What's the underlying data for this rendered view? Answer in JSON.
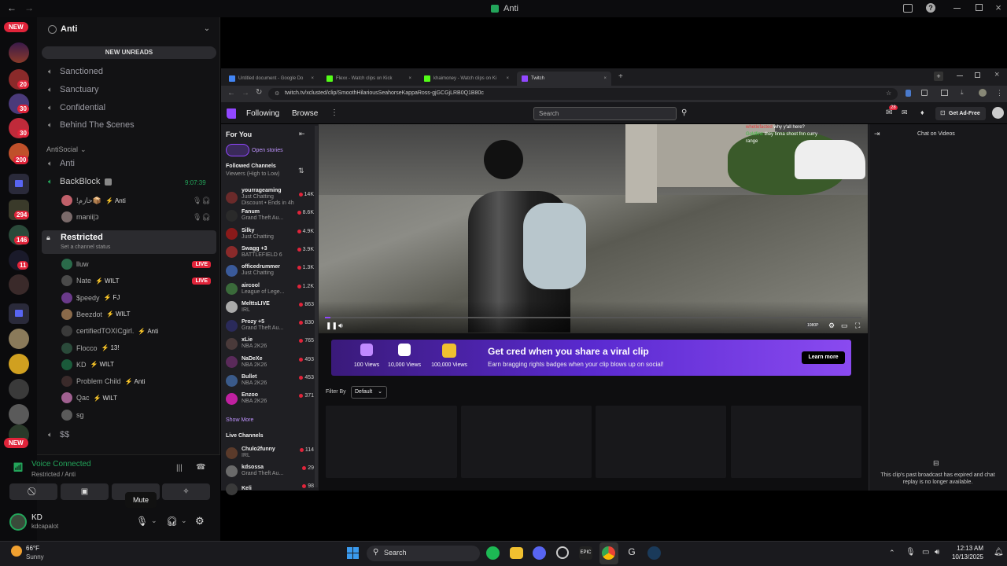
{
  "window": {
    "title": "Anti"
  },
  "rail": {
    "new_top": "NEW",
    "new_bottom": "NEW",
    "badges": [
      "20",
      "30",
      "30",
      "200",
      "294",
      "146",
      "11"
    ]
  },
  "channel_panel": {
    "server_name": "Anti",
    "new_unreads": "NEW UNREADS",
    "channels": [
      "Sanctioned",
      "Sanctuary",
      "Confidential",
      "Behind The $cenes"
    ],
    "category": "AntiSocial",
    "anti_channel": "Anti",
    "backblock": "BackBlock",
    "backblock_time": "9:07:39",
    "backblock_users": [
      {
        "name": "!حازم📦",
        "tag": "Anti"
      },
      {
        "name": "manii|כּ",
        "tag": ""
      }
    ],
    "restricted": "Restricted",
    "restricted_status": "Set a channel status",
    "restricted_users": [
      {
        "name": "lluw",
        "tag": "",
        "live": "LIVE"
      },
      {
        "name": "Nate",
        "tag": "WILT",
        "live": "LIVE"
      },
      {
        "name": "$peedy",
        "tag": "FJ",
        "live": ""
      },
      {
        "name": "Beezdot",
        "tag": "WILT",
        "live": ""
      },
      {
        "name": "certifiedTOXICgirl.",
        "tag": "Anti",
        "live": ""
      },
      {
        "name": "Flocco",
        "tag": "13!",
        "live": ""
      },
      {
        "name": "KD",
        "tag": "WILT",
        "live": ""
      },
      {
        "name": "Problem Child",
        "tag": "Anti",
        "live": ""
      },
      {
        "name": "Qac",
        "tag": "WILT",
        "live": ""
      },
      {
        "name": "sg",
        "tag": "",
        "live": ""
      }
    ],
    "dollar_channel": "$$",
    "voice_connected": "Voice Connected",
    "voice_location": "Restricted / Anti",
    "mute_tooltip": "Mute",
    "user_name": "KD",
    "user_handle": "kdcapalot"
  },
  "browser": {
    "tabs": [
      "Untitled document - Google Do",
      "Flexx - Watch clips on Kick",
      "khaimoney - Watch clips on Ki",
      "Twitch"
    ],
    "url": "twitch.tv/xclusted/clip/SmoothHilariousSeahorseKappaRoss-gjGCGjLRB0Q1B80c",
    "nav": {
      "following": "Following",
      "browse": "Browse"
    },
    "search_placeholder": "Search",
    "notif_count": "28",
    "get_ad_free": "Get Ad-Free",
    "for_you": "For You",
    "open_stories": "Open stories",
    "followed_channels": "Followed Channels",
    "followed_sort": "Viewers (High to Low)",
    "followed": [
      {
        "name": "yourrageaming",
        "game": "Just Chatting",
        "viewers": "14K",
        "extra": "Discount • Ends in 4h"
      },
      {
        "name": "Fanum",
        "game": "Grand Theft Au...",
        "viewers": "8.6K"
      },
      {
        "name": "Silky",
        "game": "Just Chatting",
        "viewers": "4.9K"
      },
      {
        "name": "Swagg +3",
        "game": "BATTLEFIELD 6",
        "viewers": "3.9K"
      },
      {
        "name": "officedrummer",
        "game": "Just Chatting",
        "viewers": "1.3K"
      },
      {
        "name": "aircool",
        "game": "League of Lege...",
        "viewers": "1.2K"
      },
      {
        "name": "MelttsLIVE",
        "game": "IRL",
        "viewers": "863"
      },
      {
        "name": "Prozy +5",
        "game": "Grand Theft Au...",
        "viewers": "830"
      },
      {
        "name": "xLie",
        "game": "NBA 2K26",
        "viewers": "765"
      },
      {
        "name": "NaDeXe",
        "game": "NBA 2K26",
        "viewers": "493"
      },
      {
        "name": "Bullet",
        "game": "NBA 2K26",
        "viewers": "453"
      },
      {
        "name": "Enzoo",
        "game": "NBA 2K26",
        "viewers": "371"
      }
    ],
    "show_more": "Show More",
    "live_channels": "Live Channels",
    "live": [
      {
        "name": "Chulo2funny",
        "game": "IRL",
        "viewers": "114"
      },
      {
        "name": "kdsossa",
        "game": "Grand Theft Au...",
        "viewers": "29"
      },
      {
        "name": "Keli",
        "game": "",
        "viewers": "98"
      }
    ],
    "video_chat": [
      {
        "user": "whetlefacted",
        "msg": "why y'all here?"
      },
      {
        "user": "Goldfinz",
        "msg": "they finna shoot fnn curry"
      },
      {
        "user": "range",
        "msg": ""
      }
    ],
    "video_quality": "1080P",
    "promo": {
      "title": "Get cred when you share a viral clip",
      "subtitle": "Earn bragging rights badges when your clip blows up on social!",
      "badges": [
        "100 Views",
        "10,000 Views",
        "100,000 Views"
      ],
      "button": "Learn more"
    },
    "filter_by": "Filter By",
    "filter_value": "Default",
    "chat_header": "Chat on Videos",
    "chat_expired": "This clip's past broadcast has expired and chat replay is no longer available."
  },
  "taskbar": {
    "weather_temp": "66°F",
    "weather_desc": "Sunny",
    "search": "Search",
    "time": "12:13 AM",
    "date": "10/13/2025"
  },
  "colors": {
    "discord_bg": "#121214",
    "twitch_purple": "#9147ff",
    "live_red": "#e0243a",
    "green": "#23a55a"
  }
}
